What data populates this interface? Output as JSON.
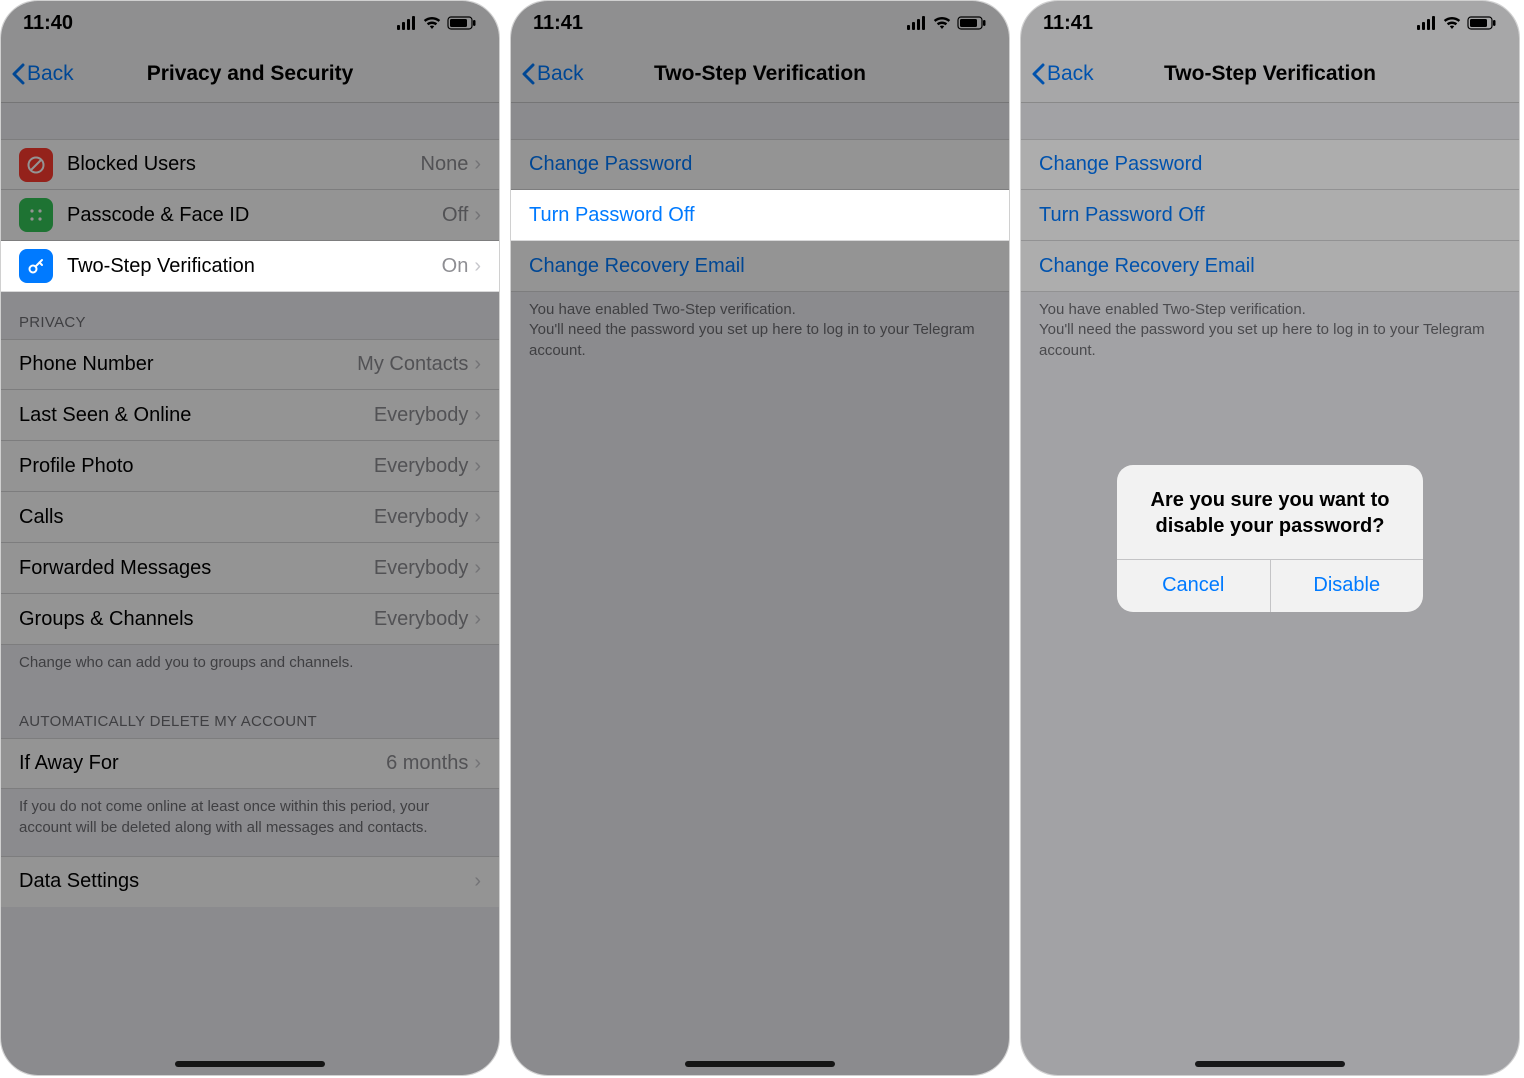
{
  "status": {
    "time_a": "11:40",
    "time_b": "11:41",
    "time_c": "11:41"
  },
  "screen1": {
    "back": "Back",
    "title": "Privacy and Security",
    "rows": {
      "blocked": {
        "label": "Blocked Users",
        "value": "None"
      },
      "passcode": {
        "label": "Passcode & Face ID",
        "value": "Off"
      },
      "twostep": {
        "label": "Two-Step Verification",
        "value": "On"
      }
    },
    "privacy_header": "Privacy",
    "privacy": {
      "phone": {
        "label": "Phone Number",
        "value": "My Contacts"
      },
      "lastseen": {
        "label": "Last Seen & Online",
        "value": "Everybody"
      },
      "photo": {
        "label": "Profile Photo",
        "value": "Everybody"
      },
      "calls": {
        "label": "Calls",
        "value": "Everybody"
      },
      "fwd": {
        "label": "Forwarded Messages",
        "value": "Everybody"
      },
      "groups": {
        "label": "Groups & Channels",
        "value": "Everybody"
      }
    },
    "privacy_footer": "Change who can add you to groups and channels.",
    "auto_header": "Automatically Delete My Account",
    "auto": {
      "label": "If Away For",
      "value": "6 months"
    },
    "auto_footer": "If you do not come online at least once within this period, your account will be deleted along with all messages and contacts.",
    "data_settings": "Data Settings"
  },
  "screen2": {
    "back": "Back",
    "title": "Two-Step Verification",
    "rows": {
      "change": "Change Password",
      "turn_off": "Turn Password Off",
      "email": "Change Recovery Email"
    },
    "footer": "You have enabled Two-Step verification.\nYou'll need the password you set up here to log in to your Telegram account."
  },
  "screen3": {
    "back": "Back",
    "title": "Two-Step Verification",
    "rows": {
      "change": "Change Password",
      "turn_off": "Turn Password Off",
      "email": "Change Recovery Email"
    },
    "footer": "You have enabled Two-Step verification.\nYou'll need the password you set up here to log in to your Telegram account.",
    "alert": {
      "title": "Are you sure you want to disable your password?",
      "cancel": "Cancel",
      "confirm": "Disable"
    }
  }
}
